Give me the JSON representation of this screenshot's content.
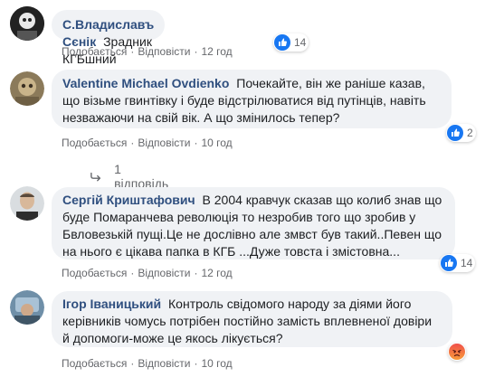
{
  "comments": [
    {
      "author": "С.Владиславъ Сєнік",
      "text": "Зрадник КГБшний",
      "like": "Подобається",
      "reply": "Відповісти",
      "time": "12 год",
      "reaction_count": "14",
      "reaction_type": "like-icon"
    },
    {
      "author": "Valentine Michael Ovdienko",
      "text": "Почекайте, він же раніше казав, що візьме гвинтівку і буде відстрілюватися від путінців, навіть незважаючи на свій вік. А що змінилось тепер?",
      "like": "Подобається",
      "reply": "Відповісти",
      "time": "10 год",
      "reaction_count": "2",
      "reaction_type": "like-icon",
      "replies": "1 відповідь"
    },
    {
      "author": "Сергій Криштафович",
      "text": "В 2004 кравчук сказав що колиб знав що буде Помаранчева революція то незробив того що зробив у Бвловезькій пущі.Це не дослівно але змвст був такий..Певен що на нього є цікава папка в КГБ ...Дуже товста і змістовна...",
      "like": "Подобається",
      "reply": "Відповісти",
      "time": "12 год",
      "reaction_count": "14",
      "reaction_type": "like-icon"
    },
    {
      "author": "Ігор Іваницький",
      "text": "Контроль свідомого народу за діями його керівників чомусь потрібен постійно замість вплевненої довіри й допомоги-може це якось лікується?",
      "like": "Подобається",
      "reply": "Відповісти",
      "time": "10 год",
      "reaction_type": "angry-icon"
    }
  ],
  "colors": {
    "bubble": "#f0f2f5",
    "author": "#2f4f7f",
    "meta": "#65676b",
    "like": "#1877f2"
  }
}
